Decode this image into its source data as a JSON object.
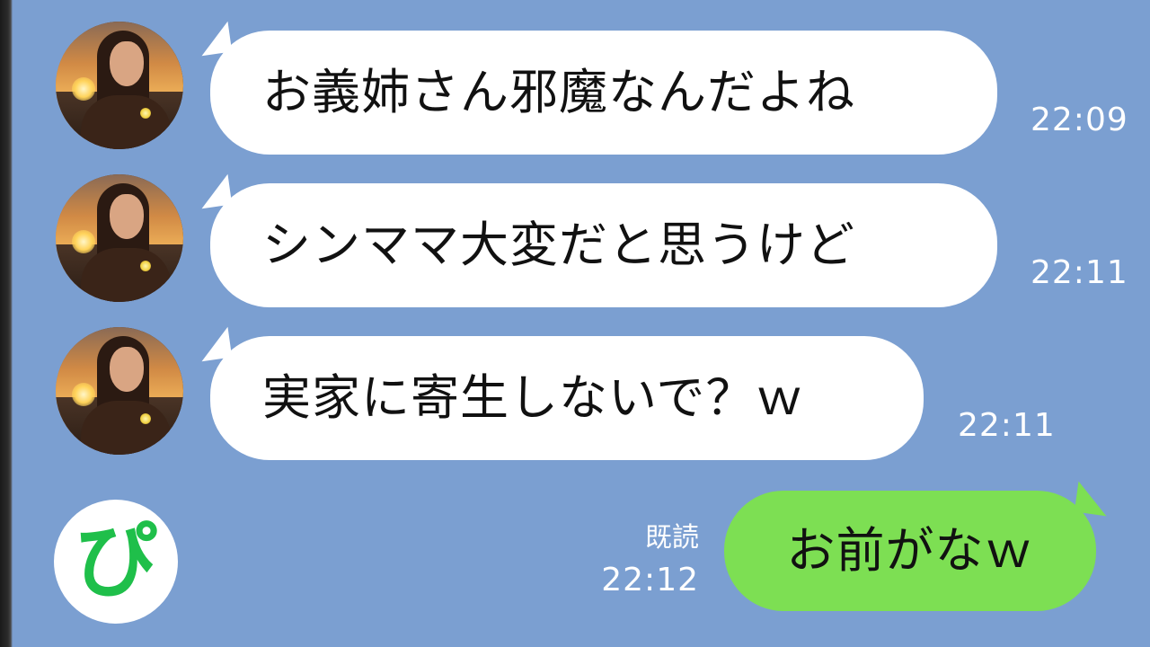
{
  "chat": {
    "messages": [
      {
        "sender": "other",
        "text": "お義姉さん邪魔なんだよね",
        "time": "22:09"
      },
      {
        "sender": "other",
        "text": "シンママ大変だと思うけど",
        "time": "22:11"
      },
      {
        "sender": "other",
        "text": "実家に寄生しないで？ｗ",
        "time": "22:11"
      },
      {
        "sender": "self",
        "text": "お前がなｗ",
        "time": "22:12",
        "status": "既読"
      }
    ]
  },
  "logo": {
    "text": "ぴ"
  },
  "colors": {
    "background": "#7b9fd1",
    "incoming_bubble": "#ffffff",
    "outgoing_bubble": "#7ddf53",
    "logo_green": "#1fbf4a"
  },
  "icons": {
    "contact_avatar": "woman-sunset-photo",
    "channel_logo": "pi-logo-icon"
  }
}
